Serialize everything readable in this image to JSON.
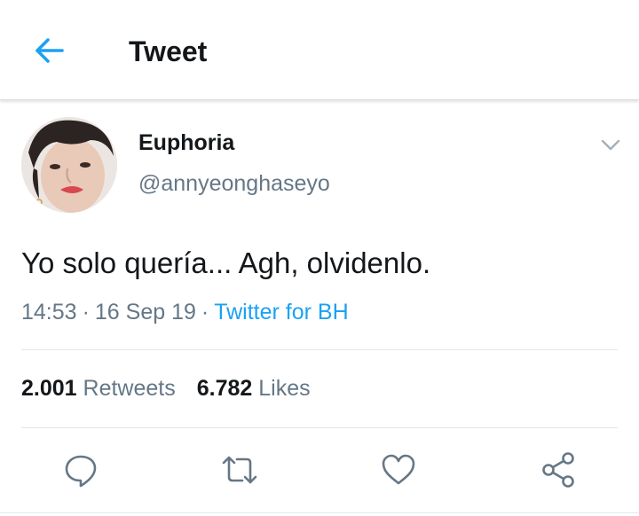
{
  "header": {
    "title": "Tweet",
    "back_icon": "arrow-left-icon"
  },
  "author": {
    "display_name": "Euphoria",
    "handle": "@annyeonghaseyo"
  },
  "tweet": {
    "text": "Yo solo quería... Agh, olvidenlo.",
    "time": "14:53",
    "date": "16 Sep 19",
    "separator": "·",
    "source": "Twitter for BH"
  },
  "stats": {
    "retweets_count": "2.001",
    "retweets_label": "Retweets",
    "likes_count": "6.782",
    "likes_label": "Likes"
  },
  "actions": [
    "reply-icon",
    "retweet-icon",
    "like-icon",
    "share-icon"
  ],
  "colors": {
    "accent": "#1da1f2",
    "secondary_text": "#657786",
    "primary_text": "#14171a",
    "icon_gray": "#657786"
  }
}
